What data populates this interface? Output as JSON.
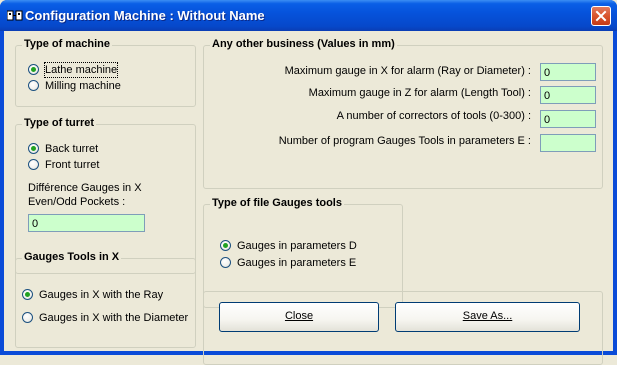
{
  "window": {
    "title": "Configuration Machine : Without Name"
  },
  "machine_group": {
    "title": "Type of machine",
    "options": [
      {
        "label": "Lathe machine",
        "selected": true
      },
      {
        "label": "Milling machine",
        "selected": false
      }
    ]
  },
  "turret_group": {
    "title": "Type of turret",
    "options": [
      {
        "label": "Back turret",
        "selected": true
      },
      {
        "label": "Front turret",
        "selected": false
      }
    ],
    "diff_label_1": "Différence Gauges in X",
    "diff_label_2": "Even/Odd Pockets :",
    "diff_value": "0"
  },
  "gauges_x_group": {
    "title": "Gauges Tools in X",
    "options": [
      {
        "label": "Gauges in X with the Ray",
        "selected": true
      },
      {
        "label": "Gauges in X with the Diameter",
        "selected": false
      }
    ]
  },
  "other_group": {
    "title": "Any other business (Values in mm)",
    "fields": [
      {
        "label": "Maximum gauge in X for alarm (Ray or Diameter) :",
        "value": "0"
      },
      {
        "label": "Maximum gauge in Z for alarm (Length Tool) :",
        "value": "0"
      },
      {
        "label": "A number of correctors of tools (0-300) :",
        "value": "0"
      },
      {
        "label": "Number of program Gauges Tools in parameters E :",
        "value": ""
      }
    ]
  },
  "file_group": {
    "title": "Type of file Gauges tools",
    "options": [
      {
        "label": "Gauges in parameters D",
        "selected": true
      },
      {
        "label": "Gauges in parameters E",
        "selected": false
      }
    ]
  },
  "buttons": {
    "close": "Close",
    "save_as": "Save As..."
  },
  "colors": {
    "titlebar": "#0653DC",
    "dialog_bg": "#ECE9D8",
    "textbox_bg": "#CCFFCC",
    "close_button": "#D9542C"
  }
}
